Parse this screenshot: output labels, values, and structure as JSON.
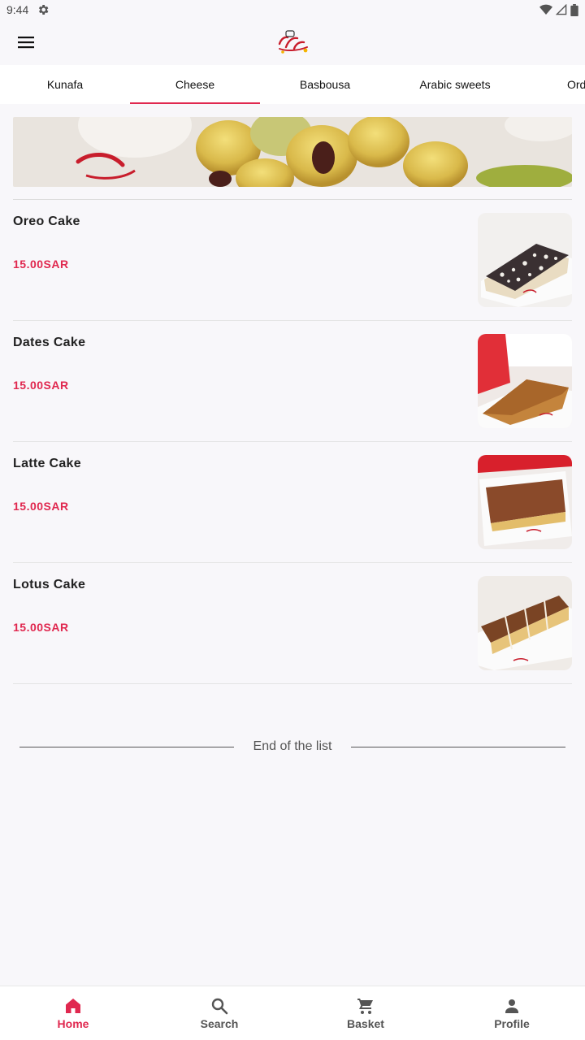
{
  "status_bar": {
    "time": "9:44"
  },
  "tabs": [
    {
      "label": "Kunafa"
    },
    {
      "label": "Cheese"
    },
    {
      "label": "Basbousa"
    },
    {
      "label": "Arabic sweets"
    },
    {
      "label": "Ord"
    }
  ],
  "active_tab": "Cheese",
  "products": [
    {
      "name": "Oreo Cake",
      "price": "15.00SAR"
    },
    {
      "name": "Dates Cake",
      "price": "15.00SAR"
    },
    {
      "name": "Latte Cake",
      "price": "15.00SAR"
    },
    {
      "name": "Lotus Cake",
      "price": "15.00SAR"
    }
  ],
  "end_of_list": "End of the list",
  "bottom_nav": {
    "home": "Home",
    "search": "Search",
    "basket": "Basket",
    "profile": "Profile"
  },
  "colors": {
    "accent": "#e0284f",
    "background": "#f8f7fa"
  },
  "icons": {
    "menu": "menu-icon",
    "home": "home-icon",
    "search": "search-icon",
    "basket": "cart-icon",
    "profile": "person-icon"
  }
}
